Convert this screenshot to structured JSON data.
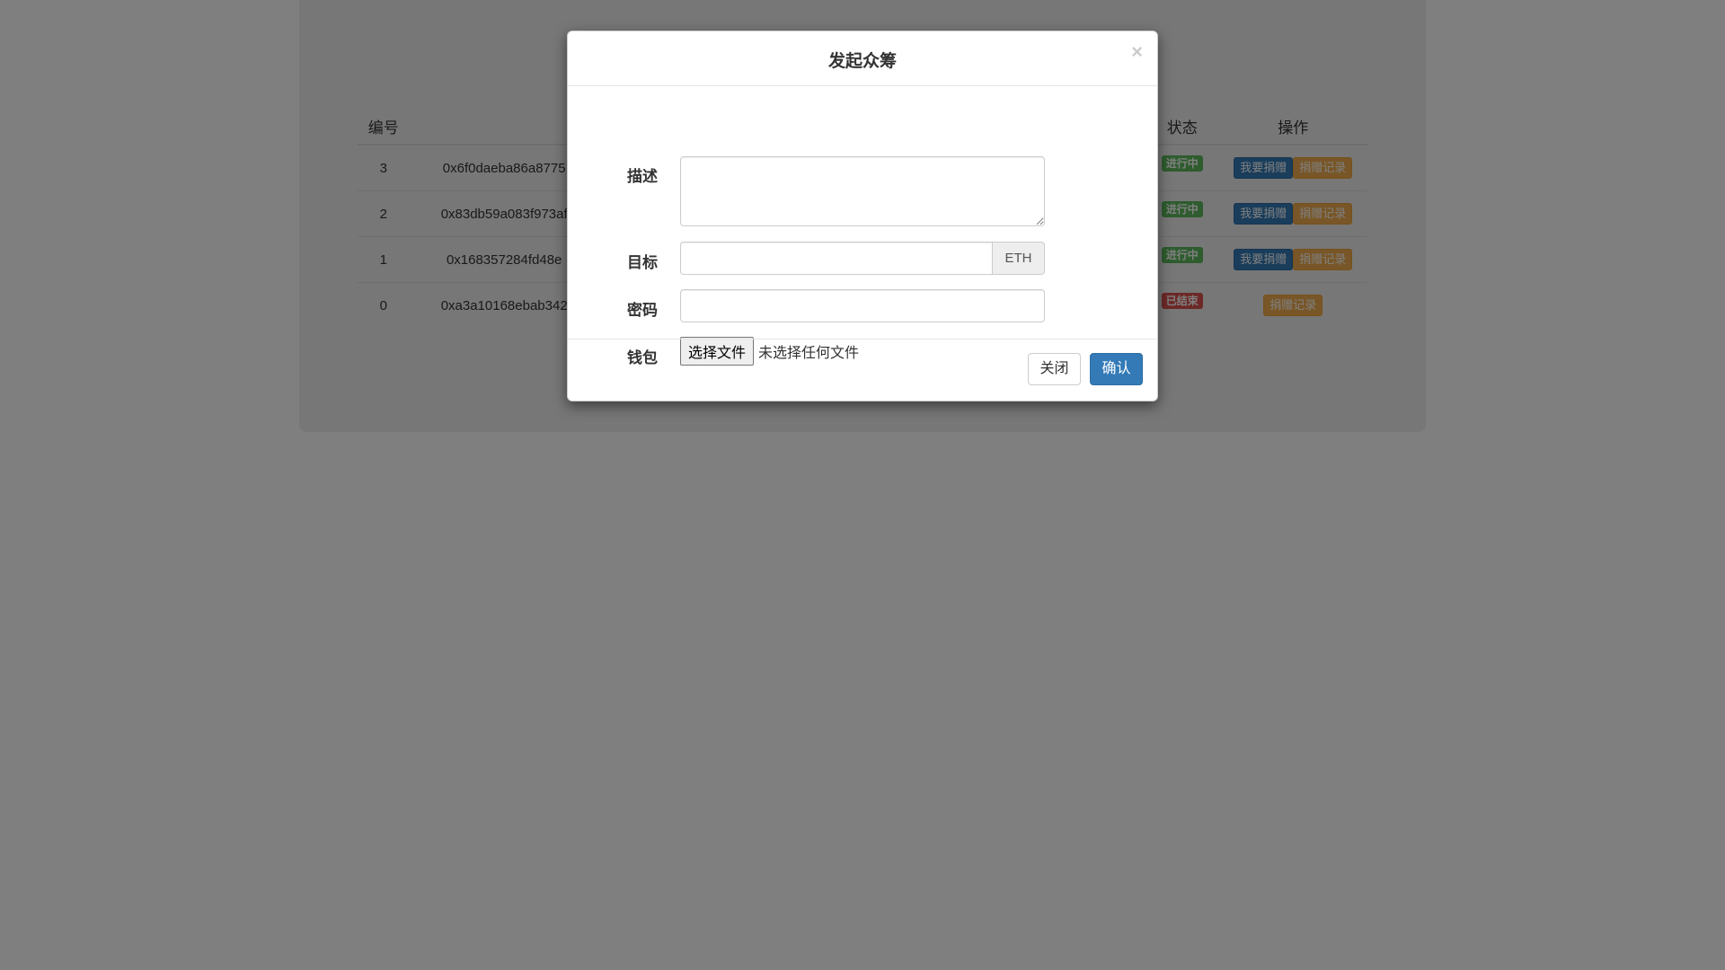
{
  "table": {
    "headers": {
      "id": "编号",
      "status": "状态",
      "ops": "操作"
    },
    "rows": [
      {
        "id": "3",
        "address": "0x6f0daeba86a8775",
        "status": "进行中",
        "status_type": "active",
        "donate": "我要捐赠",
        "records": "捐赠记录"
      },
      {
        "id": "2",
        "address": "0x83db59a083f973af",
        "status": "进行中",
        "status_type": "active",
        "donate": "我要捐赠",
        "records": "捐赠记录"
      },
      {
        "id": "1",
        "address": "0x168357284fd48e",
        "status": "进行中",
        "status_type": "active",
        "donate": "我要捐赠",
        "records": "捐赠记录"
      },
      {
        "id": "0",
        "address": "0xa3a10168ebab342",
        "status": "已结束",
        "status_type": "ended",
        "donate": "",
        "records": "捐赠记录"
      }
    ]
  },
  "modal": {
    "title": "发起众筹",
    "close_symbol": "×",
    "fields": {
      "description_label": "描述",
      "description_value": "",
      "target_label": "目标",
      "target_value": "",
      "target_unit": "ETH",
      "password_label": "密码",
      "password_value": "",
      "wallet_label": "钱包",
      "file_button": "选择文件",
      "file_status": "未选择任何文件"
    },
    "footer": {
      "close_label": "关闭",
      "confirm_label": "确认"
    }
  },
  "colors": {
    "primary": "#337ab7",
    "success": "#5cb85c",
    "danger": "#d9534f",
    "warning": "#f0ad4e"
  }
}
